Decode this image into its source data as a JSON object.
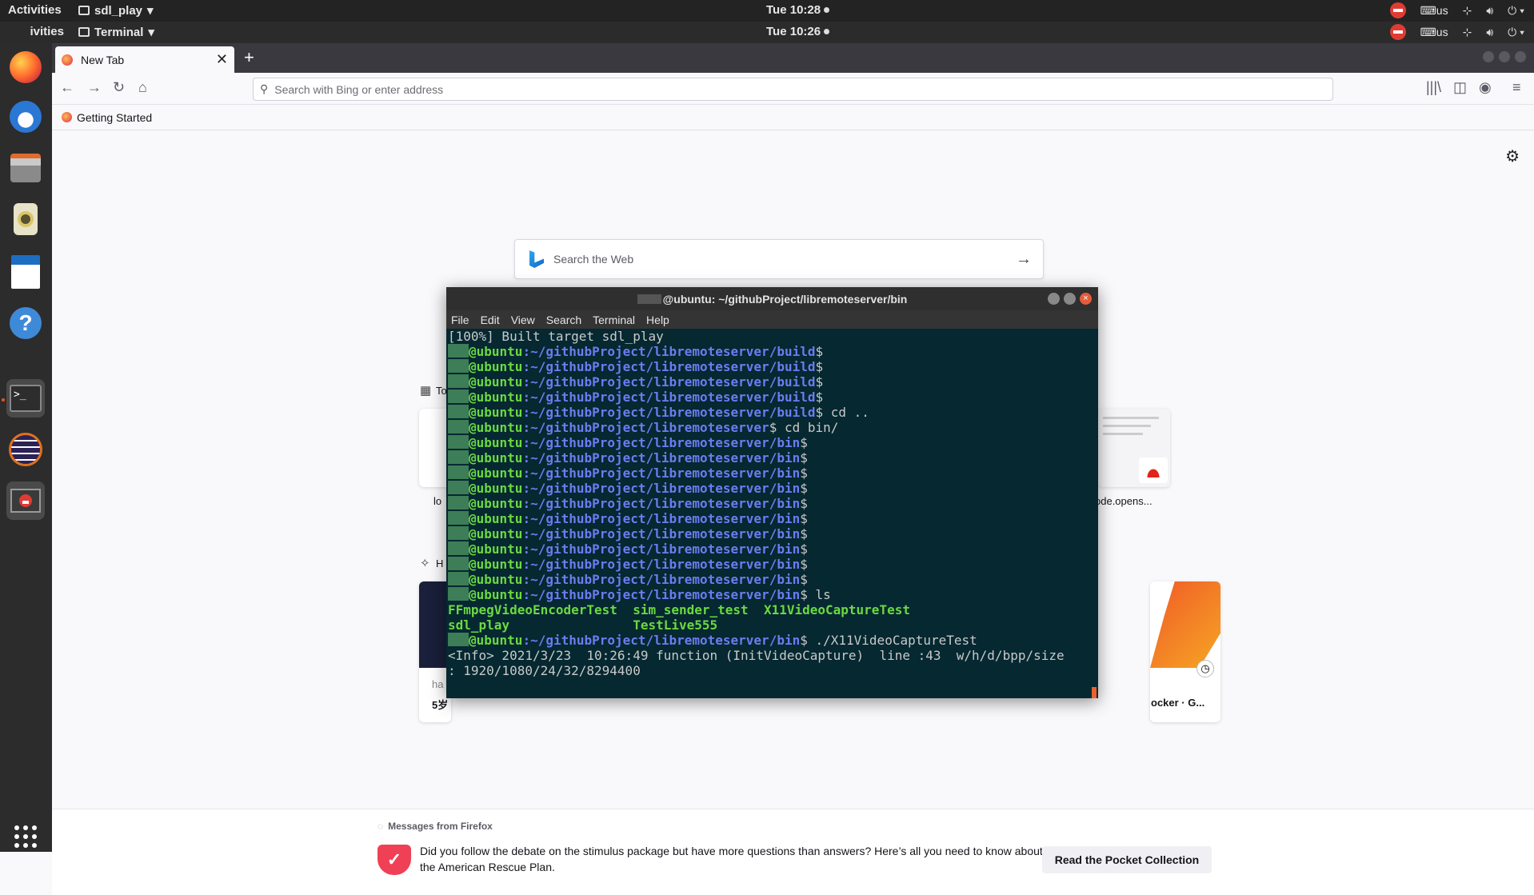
{
  "panel1": {
    "activities": "Activities",
    "app_name": "sdl_play",
    "clock": "Tue 10:28",
    "kbd": "us"
  },
  "panel2": {
    "activities": "Activities",
    "app_name": "Terminal",
    "clock": "Tue 10:26",
    "kbd": "us"
  },
  "dock": {
    "items": [
      "firefox-icon",
      "thunderbird-icon",
      "files-icon",
      "rhythmbox-icon",
      "writer-icon",
      "help-icon",
      "terminal-icon",
      "eclipse-icon",
      "blocked-app-icon",
      "show-apps-icon"
    ]
  },
  "browser": {
    "tab_title": "New Tab",
    "address_placeholder": "Search with Bing or enter address",
    "bookmark": "Getting Started",
    "web_search_placeholder": "Search the Web",
    "tiles": {
      "left_label": "lo",
      "right_label": "ode.opens...",
      "bottom_left_label": "5岁",
      "bottom_left_sub": "ha",
      "bottom_right_label": "ocker · G..."
    },
    "section_top": "To",
    "section_highlights": "H"
  },
  "message": {
    "header": "Messages from Firefox",
    "body": "Did you follow the debate on the stimulus package but have more questions than answers? Here’s all you need to know about the American Rescue Plan.",
    "button": "Read the Pocket Collection"
  },
  "terminal": {
    "title": "@ubuntu: ~/githubProject/libremoteserver/bin",
    "menu": [
      "File",
      "Edit",
      "View",
      "Search",
      "Terminal",
      "Help"
    ],
    "first_line": "[100%] Built target sdl_play",
    "host": "@ubuntu",
    "build_path": ":~/githubProject/libremoteserver/build",
    "root_path": ":~/githubProject/libremoteserver",
    "bin_path": ":~/githubProject/libremoteserver/bin",
    "cmd_cd_up": " cd ..",
    "cmd_cd_bin": " cd bin/",
    "cmd_ls": " ls",
    "ls_row1": "FFmpegVideoEncoderTest  sim_sender_test  X11VideoCaptureTest",
    "ls_row2": "sdl_play                TestLive555",
    "cmd_run": " ./X11VideoCaptureTest",
    "info_line1": "<Info> 2021/3/23  10:26:49 function (InitVideoCapture)  line :43  w/h/d/bpp/size",
    "info_line2": ": 1920/1080/24/32/8294400",
    "dollar": "$"
  }
}
